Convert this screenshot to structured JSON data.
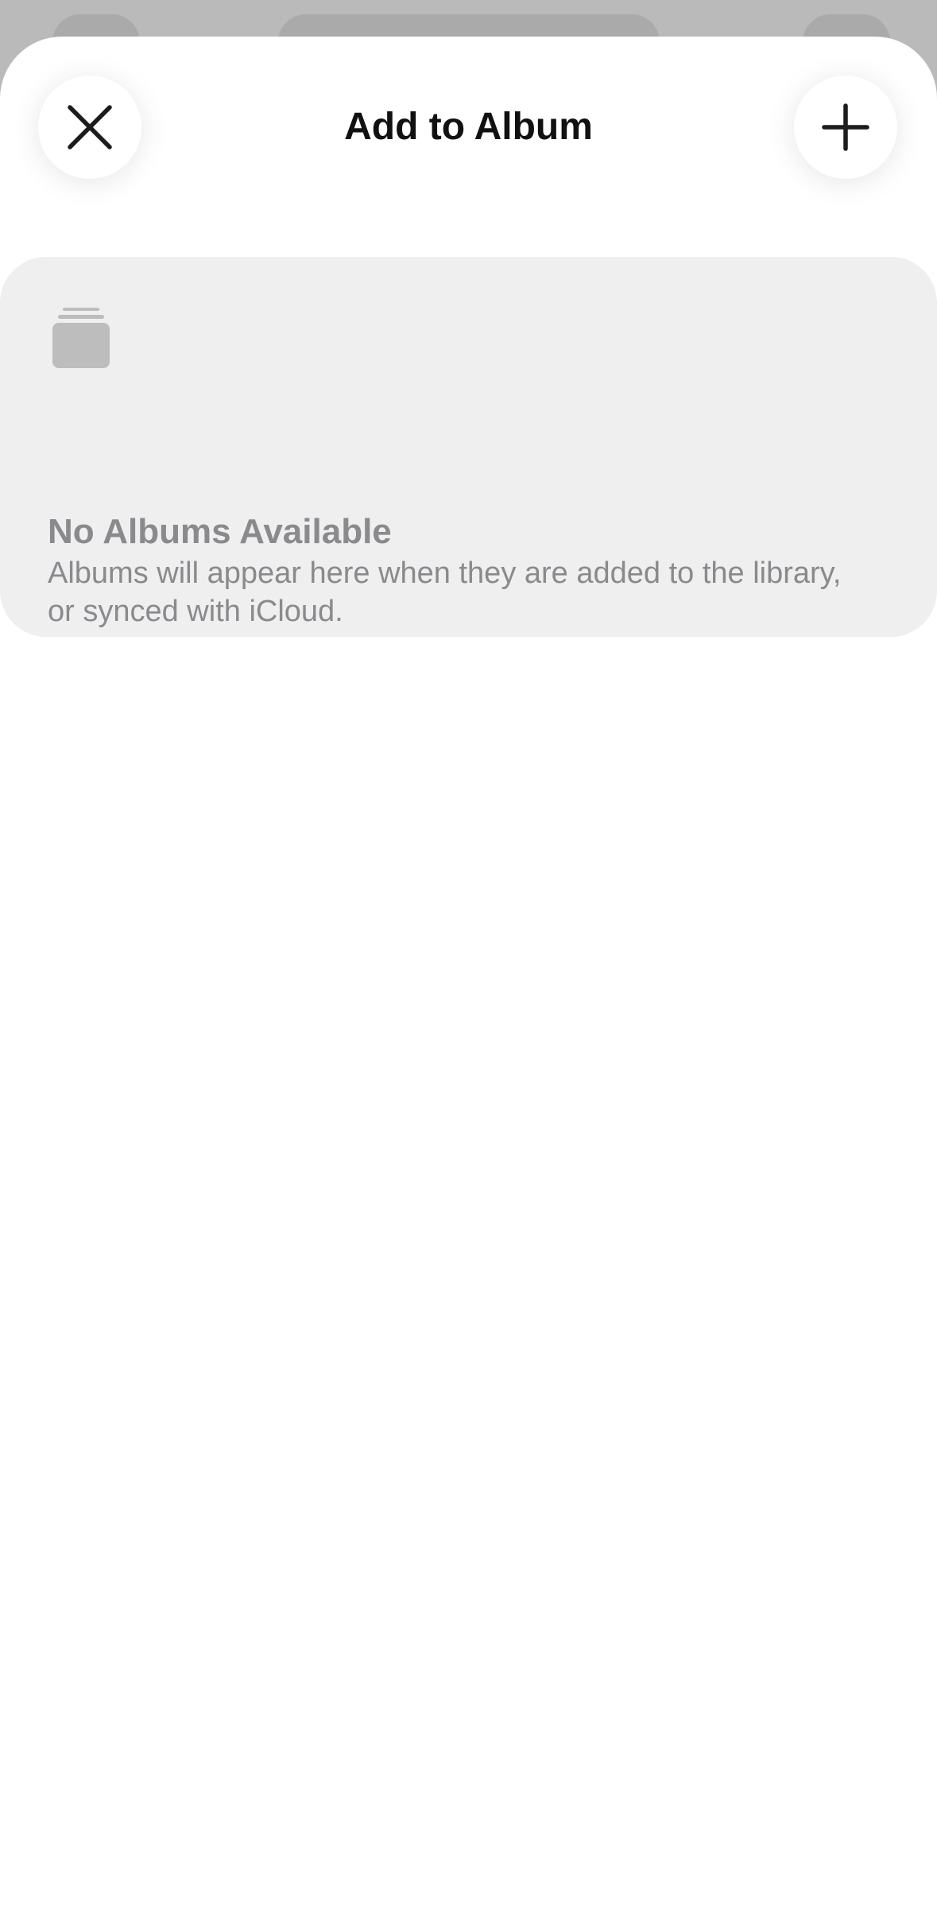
{
  "sheet": {
    "title": "Add to Album",
    "close_icon": "close-icon",
    "add_icon": "plus-icon"
  },
  "empty_state": {
    "icon": "album-stack-icon",
    "title": "No Albums Available",
    "message": "Albums will appear here when they are added to the library, or synced with iCloud."
  },
  "colors": {
    "sheet_background": "#ffffff",
    "card_background": "#efefef",
    "secondary_text": "#8a8a8e",
    "icon_gray": "#bdbdbd",
    "dimmed_backdrop": "#b9bab9"
  }
}
